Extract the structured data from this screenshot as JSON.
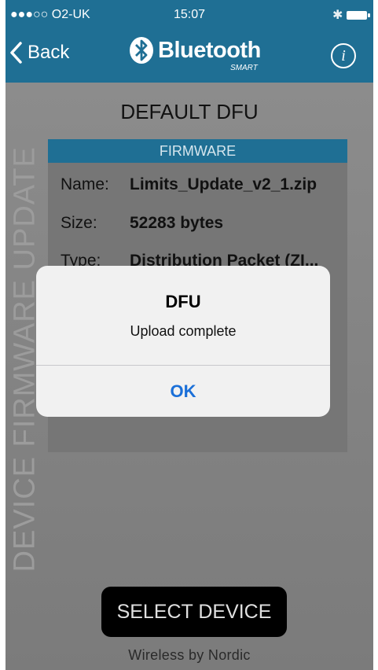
{
  "status_bar": {
    "carrier": "●●●○○ O2-UK",
    "time": "15:07"
  },
  "nav": {
    "back_label": "Back",
    "brand_name": "Bluetooth",
    "brand_suffix": "SMART",
    "info_label": "i"
  },
  "page": {
    "title": "DEFAULT DFU",
    "vertical_label": "DEVICE FIRMWARE UPDATE"
  },
  "firmware": {
    "header": "FIRMWARE",
    "rows": [
      {
        "key": "Name:",
        "value": "Limits_Update_v2_1.zip"
      },
      {
        "key": "Size:",
        "value": "52283 bytes"
      },
      {
        "key": "Type:",
        "value": "Distribution Packet (ZI..."
      }
    ]
  },
  "alert": {
    "title": "DFU",
    "message": "Upload complete",
    "ok_label": "OK"
  },
  "actions": {
    "select_device_label": "SELECT DEVICE"
  },
  "footer": {
    "text": "Wireless by Nordic"
  },
  "colors": {
    "nav_blue": "#1f6f94",
    "alert_button_blue": "#1a6fd8",
    "overlay_grey": "#8a8a8a"
  }
}
